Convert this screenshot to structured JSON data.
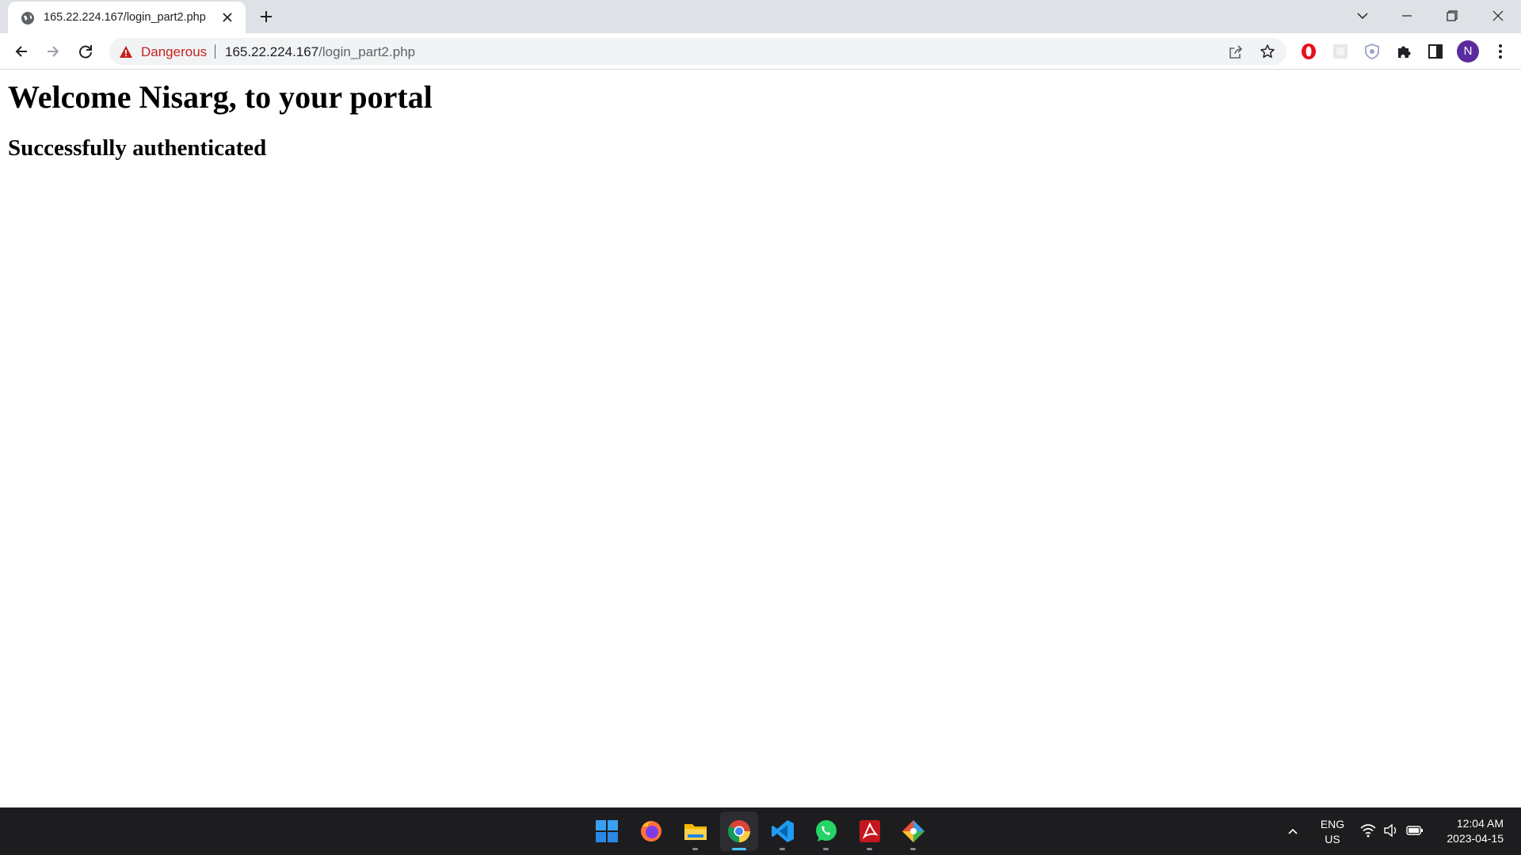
{
  "browser": {
    "tab": {
      "title": "165.22.224.167/login_part2.php",
      "favicon": "globe-icon"
    },
    "omnibox": {
      "security_label": "Dangerous",
      "url_host": "165.22.224.167",
      "url_path": "/login_part2.php"
    },
    "profile_initial": "N",
    "colors": {
      "danger": "#c5221f",
      "avatar": "#5b2c9e",
      "tabstrip": "#dee1e6"
    }
  },
  "page": {
    "heading": "Welcome Nisarg, to your portal",
    "subheading": "Successfully authenticated"
  },
  "taskbar": {
    "apps": [
      "start-icon",
      "firefox-icon",
      "file-explorer-icon",
      "chrome-icon",
      "vscode-icon",
      "whatsapp-icon",
      "acrobat-icon",
      "git-icon"
    ],
    "active_app": "chrome-icon",
    "language": {
      "line1": "ENG",
      "line2": "US"
    },
    "clock": {
      "time": "12:04 AM",
      "date": "2023-04-15"
    }
  }
}
